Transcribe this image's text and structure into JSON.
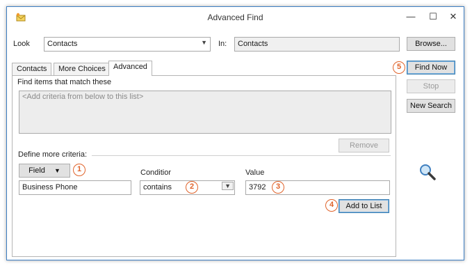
{
  "window": {
    "title": "Advanced Find",
    "minimize": "—",
    "maximize": "☐",
    "close": "✕"
  },
  "look": {
    "label": "Look",
    "value": "Contacts"
  },
  "in": {
    "label": "In:",
    "value": "Contacts"
  },
  "buttons": {
    "browse": "Browse...",
    "find_now": "Find Now",
    "stop": "Stop",
    "new_search": "New Search",
    "remove": "Remove",
    "add_to_list": "Add to List",
    "field": "Field"
  },
  "tabs": [
    {
      "label": "Contacts"
    },
    {
      "label": "More Choices"
    },
    {
      "label": "Advanced"
    }
  ],
  "find_items_label": "Find items that match these",
  "criteria_placeholder": "<Add criteria from below to this list>",
  "define_more_label": "Define more criteria:",
  "condition": {
    "label": "Conditior",
    "value": "contains"
  },
  "value": {
    "label": "Value",
    "value": "3792"
  },
  "field_value": "Business Phone",
  "badges": [
    "1",
    "2",
    "3",
    "4",
    "5"
  ],
  "colors": {
    "badge": "#e0632a",
    "accent": "#3d7ec3"
  }
}
